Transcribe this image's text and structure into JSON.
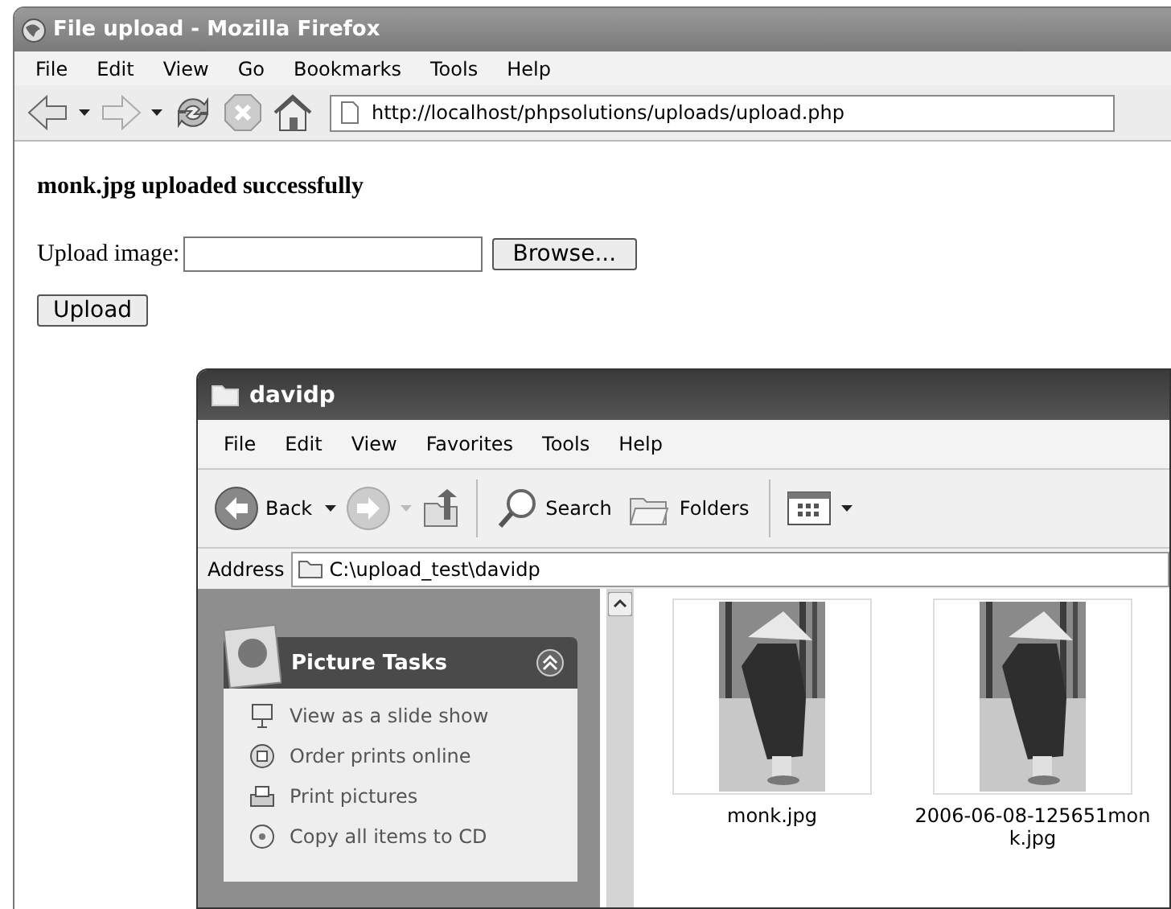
{
  "browser": {
    "title": "File upload - Mozilla Firefox",
    "menu": [
      "File",
      "Edit",
      "View",
      "Go",
      "Bookmarks",
      "Tools",
      "Help"
    ],
    "address": "http://localhost/phpsolutions/uploads/upload.php"
  },
  "page": {
    "message": "monk.jpg uploaded successfully",
    "field_label": "Upload image:",
    "browse_button": "Browse...",
    "upload_button": "Upload"
  },
  "explorer": {
    "title": "davidp",
    "menu": [
      "File",
      "Edit",
      "View",
      "Favorites",
      "Tools",
      "Help"
    ],
    "toolbar": {
      "back": "Back",
      "search": "Search",
      "folders": "Folders"
    },
    "address_label": "Address",
    "address": "C:\\upload_test\\davidp",
    "tasks": {
      "title": "Picture Tasks",
      "items": [
        "View as a slide show",
        "Order prints online",
        "Print pictures",
        "Copy all items to CD"
      ]
    },
    "files": [
      {
        "name": "monk.jpg",
        "kind": "picture"
      },
      {
        "name": "2006-06-08-125651monk.jpg",
        "kind": "picture"
      }
    ]
  }
}
